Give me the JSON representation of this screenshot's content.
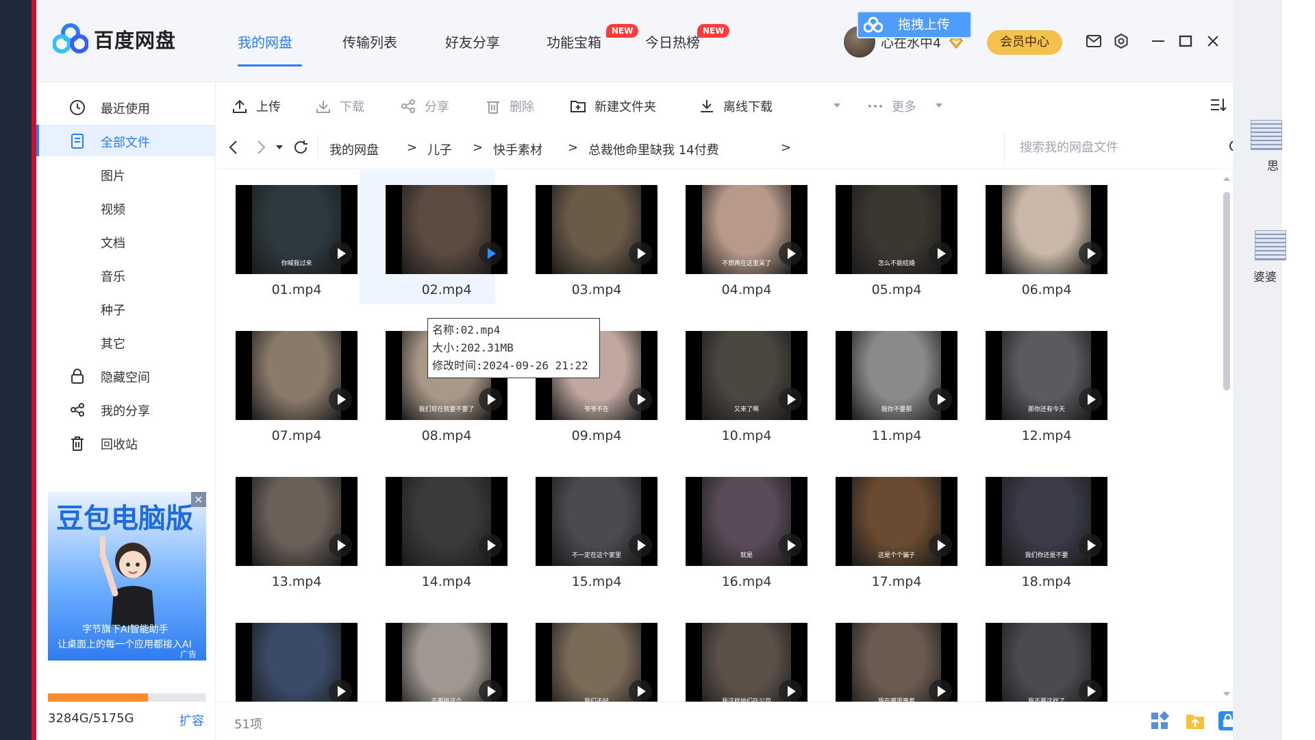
{
  "app": {
    "brand": "百度网盘",
    "nav": [
      {
        "label": "我的网盘",
        "active": true
      },
      {
        "label": "传输列表"
      },
      {
        "label": "好友分享"
      },
      {
        "label": "功能宝箱",
        "badge": "NEW"
      },
      {
        "label": "今日热榜",
        "badge": "NEW"
      }
    ],
    "drag_upload": "拖拽上传",
    "username": "心在水中4",
    "member_center": "会员中心"
  },
  "sidebar": {
    "items": [
      {
        "label": "最近使用",
        "icon": "clock-icon"
      },
      {
        "label": "全部文件",
        "icon": "file-icon",
        "active": true
      },
      {
        "label": "图片"
      },
      {
        "label": "视频"
      },
      {
        "label": "文档"
      },
      {
        "label": "音乐"
      },
      {
        "label": "种子"
      },
      {
        "label": "其它"
      },
      {
        "label": "隐藏空间",
        "icon": "lock-icon"
      },
      {
        "label": "我的分享",
        "icon": "share-icon"
      },
      {
        "label": "回收站",
        "icon": "trash-icon"
      }
    ],
    "ad": {
      "title": "豆包电脑版",
      "line1": "字节旗下AI智能助手",
      "line2": "让桌面上的每一个应用都接入AI",
      "tag": "广告",
      "close": "×"
    },
    "storage": {
      "used": "3284G",
      "total": "5175G",
      "text": "3284G/5175G",
      "used_fraction": 0.634,
      "expand": "扩容"
    }
  },
  "toolbar": {
    "upload": "上传",
    "download": "下载",
    "share": "分享",
    "delete": "删除",
    "new_folder": "新建文件夹",
    "offline_download": "离线下载",
    "more": "更多"
  },
  "breadcrumb": [
    "我的网盘",
    "儿子",
    "快手素材",
    "总裁他命里缺我 14付费"
  ],
  "breadcrumb_sep": ">",
  "search": {
    "placeholder": "搜索我的网盘文件"
  },
  "files": [
    {
      "name": "01.mp4",
      "caption": "你喊我过来",
      "color": "#2c3a40"
    },
    {
      "name": "02.mp4",
      "caption": "",
      "color": "#5a4a40"
    },
    {
      "name": "03.mp4",
      "caption": "",
      "color": "#6a5a48"
    },
    {
      "name": "04.mp4",
      "caption": "不想再在这里呆了",
      "color": "#b89a8a"
    },
    {
      "name": "05.mp4",
      "caption": "怎么不能结婚",
      "color": "#3a3630"
    },
    {
      "name": "06.mp4",
      "caption": "",
      "color": "#c9b8a8"
    },
    {
      "name": "07.mp4",
      "caption": "",
      "color": "#8a7a6a"
    },
    {
      "name": "08.mp4",
      "caption": "我们现在就要不要了",
      "color": "#a89888"
    },
    {
      "name": "09.mp4",
      "caption": "爷爷不在",
      "color": "#c0a8a0"
    },
    {
      "name": "10.mp4",
      "caption": "又来了啊",
      "color": "#4a4640"
    },
    {
      "name": "11.mp4",
      "caption": "我你不要那",
      "color": "#8a8a88"
    },
    {
      "name": "12.mp4",
      "caption": "那你还有今天",
      "color": "#5a5a60"
    },
    {
      "name": "13.mp4",
      "caption": "",
      "color": "#6a6058"
    },
    {
      "name": "14.mp4",
      "caption": "",
      "color": "#3a3a3a"
    },
    {
      "name": "15.mp4",
      "caption": "不一定在这个家里",
      "color": "#4a4a50"
    },
    {
      "name": "16.mp4",
      "caption": "就是",
      "color": "#5a4a58"
    },
    {
      "name": "17.mp4",
      "caption": "这是个个骗子",
      "color": "#6a4a30"
    },
    {
      "name": "18.mp4",
      "caption": "我们你还是不要",
      "color": "#3a3a48"
    },
    {
      "name": "",
      "caption": "",
      "color": "#3a4a68"
    },
    {
      "name": "",
      "caption": "不要碰这个",
      "color": "#a09890"
    },
    {
      "name": "",
      "caption": "我们不好",
      "color": "#7a6a58"
    },
    {
      "name": "",
      "caption": "我这样他们在公司",
      "color": "#5a5048"
    },
    {
      "name": "",
      "caption": "我在哪里等着",
      "color": "#6a5a50"
    },
    {
      "name": "",
      "caption": "我不要这样了",
      "color": "#4a4a50"
    }
  ],
  "tooltip": {
    "name": "名称:02.mp4",
    "size": "大小:202.31MB",
    "modified": "修改时间:2024-09-26 21:22"
  },
  "status": {
    "count": "51项"
  },
  "desktop": {
    "label1": "思",
    "label2": "婆婆"
  }
}
